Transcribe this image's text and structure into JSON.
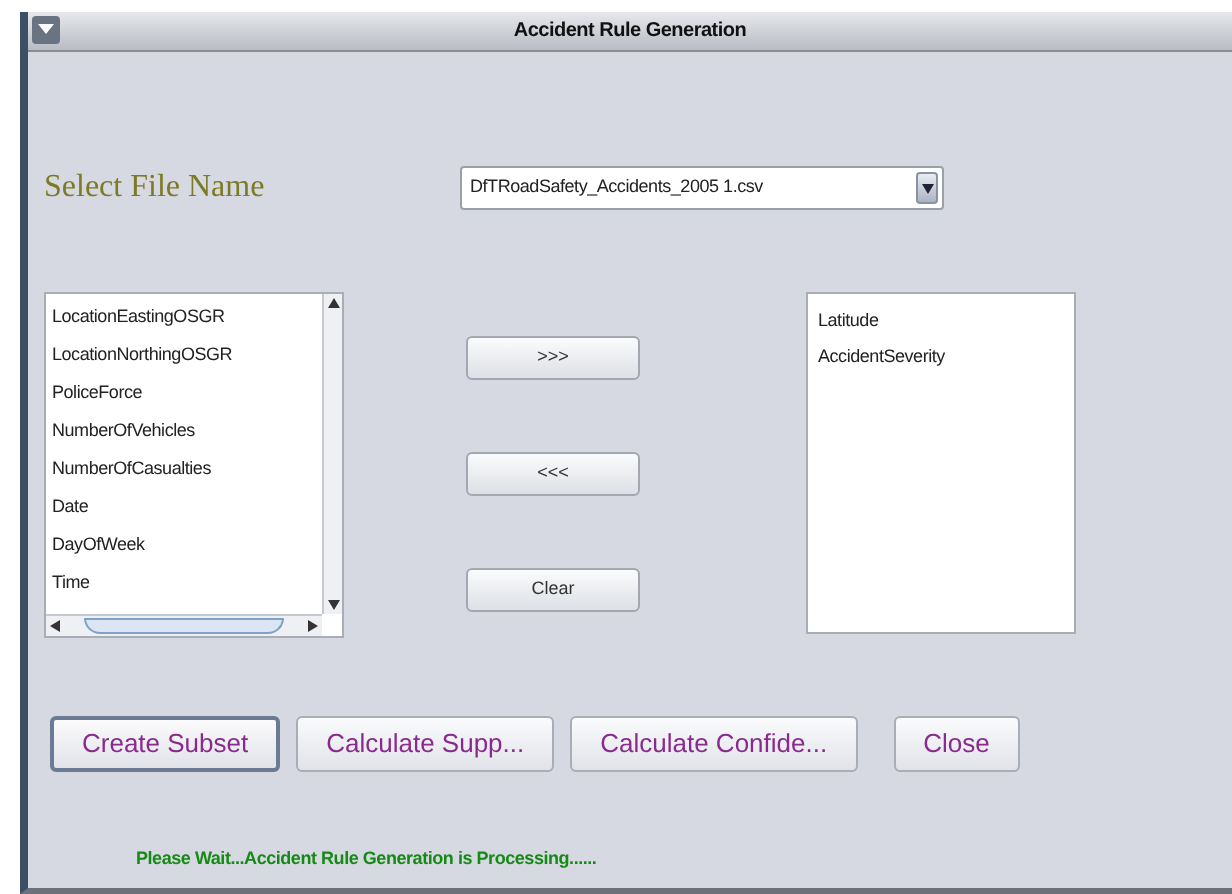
{
  "window": {
    "title": "Accident Rule Generation"
  },
  "file_select": {
    "label": "Select File Name",
    "value": "DfTRoadSafety_Accidents_2005 1.csv"
  },
  "available_fields": [
    "LocationEastingOSGR",
    "LocationNorthingOSGR",
    "PoliceForce",
    "NumberOfVehicles",
    "NumberOfCasualties",
    "Date",
    "DayOfWeek",
    "Time"
  ],
  "move_buttons": [
    ">>>",
    "<<<",
    "Clear"
  ],
  "selected_fields": [
    "Latitude",
    "AccidentSeverity"
  ],
  "action_buttons": [
    {
      "label": "Create Subset",
      "focused": true
    },
    {
      "label": "Calculate Supp...",
      "focused": false
    },
    {
      "label": "Calculate Confide...",
      "focused": false
    },
    {
      "label": "Close",
      "focused": false
    }
  ],
  "status": "Please Wait...Accident Rule Generation is Processing......"
}
